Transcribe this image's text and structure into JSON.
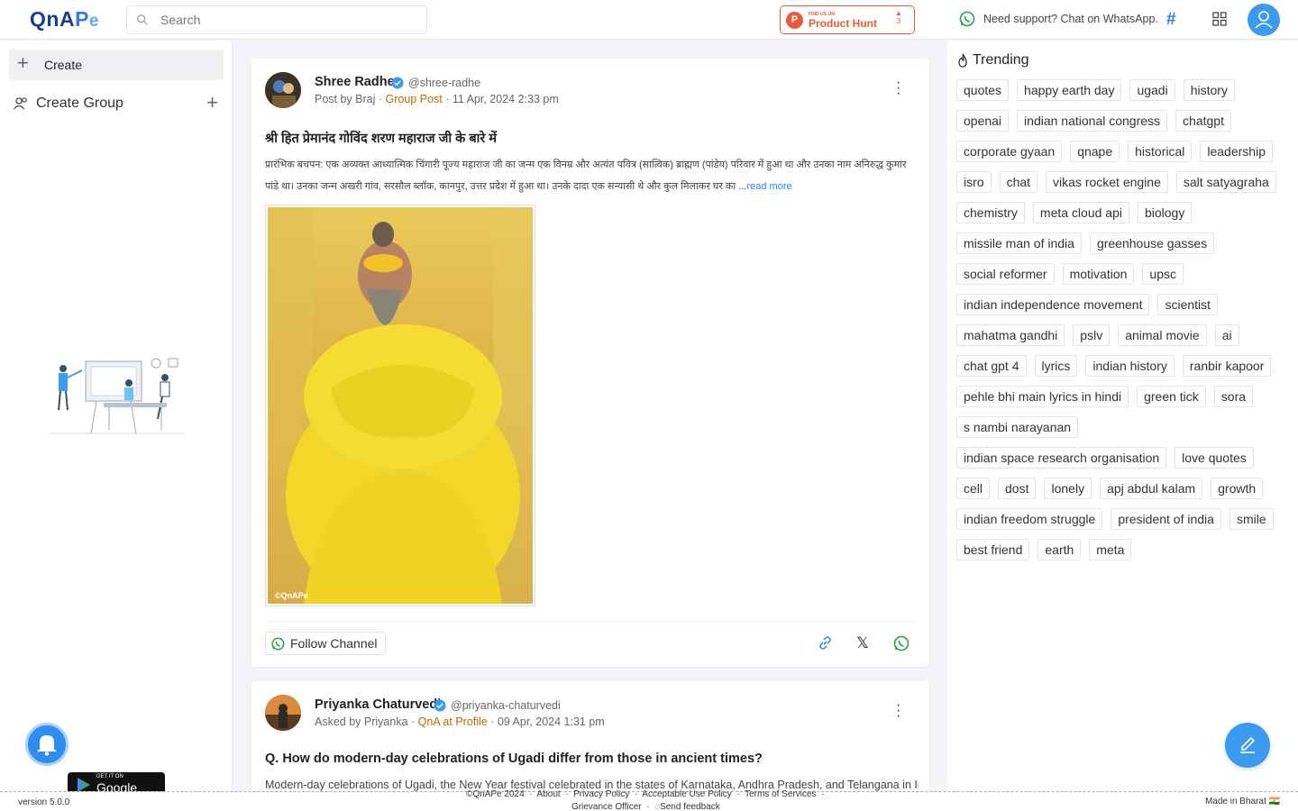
{
  "header": {
    "logo": {
      "part1": "QnA",
      "part2": "P",
      "part3": "e"
    },
    "search_placeholder": "Search",
    "product_hunt": {
      "small": "FIND US ON",
      "big": "Product Hunt",
      "upvotes": "3"
    },
    "support_text": "Need support? Chat on WhatsApp."
  },
  "sidebar": {
    "create_label": "Create",
    "create_group_label": "Create Group",
    "google_play": {
      "small": "GET IT ON",
      "big": "Google Play"
    }
  },
  "posts": [
    {
      "author": "Shree Radhe",
      "handle": "@shree-radhe",
      "meta_prefix": "Post by Braj · ",
      "meta_link": "Group Post",
      "meta_suffix": " · 11 Apr, 2024 2:33 pm",
      "title": "श्री हित प्रेमानंद गोविंद शरण महाराज जी के बारे में",
      "body": "प्रारंभिक बचपन: एक अव्यक्त आध्यात्मिक चिंगारी पूज्य महाराज जी का जन्म एक विनम्र और अत्यंत पवित्र (सात्विक) ब्राह्मण (पांडेय) परिवार में हुआ था और उनका नाम अनिरुद्ध कुमार पांडे था। उनका जन्म अखरी गांव, सरसौल ब्लॉक, कानपुर, उत्तर प्रदेश में हुआ था। उनके दादा एक सन्यासी थे और कुल मिलाकर घर का ...",
      "read_more": "read more",
      "image_watermark": "©QnAPe",
      "follow_label": "Follow Channel"
    },
    {
      "author": "Priyanka Chaturvedi",
      "handle": "@priyanka-chaturvedi",
      "meta_prefix": "Asked by Priyanka · ",
      "meta_link": "QnA at Profile",
      "meta_suffix": " · 09 Apr, 2024 1:31 pm",
      "title": "Q. How do modern-day celebrations of Ugadi differ from those in ancient times?",
      "body": "Modern-day celebrations of Ugadi, the New Year festival celebrated in the states of Karnataka, Andhra Pradesh, and Telangana in India,"
    }
  ],
  "trending": {
    "title": "Trending",
    "tags": [
      "quotes",
      "happy earth day",
      "ugadi",
      "history",
      "openai",
      "indian national congress",
      "chatgpt",
      "corporate gyaan",
      "qnape",
      "historical",
      "leadership",
      "isro",
      "chat",
      "vikas rocket engine",
      "salt satyagraha",
      "chemistry",
      "meta cloud api",
      "biology",
      "missile man of india",
      "greenhouse gasses",
      "social reformer",
      "motivation",
      "upsc",
      "indian independence movement",
      "scientist",
      "mahatma gandhi",
      "pslv",
      "animal movie",
      "ai",
      "chat gpt 4",
      "lyrics",
      "indian history",
      "ranbir kapoor",
      "pehle bhi main lyrics in hindi",
      "green tick",
      "sora",
      "s nambi narayanan",
      "indian space research organisation",
      "love quotes",
      "cell",
      "dost",
      "lonely",
      "apj abdul kalam",
      "growth",
      "indian freedom struggle",
      "president of india",
      "smile",
      "best friend",
      "earth",
      "meta"
    ]
  },
  "footer": {
    "version": "version 5.0.0",
    "copyright": "©QnAPe 2024",
    "about": "About",
    "privacy": "Privacy Policy",
    "aup": "Acceptable Use Policy",
    "terms": "Terms of Services",
    "grievance": "Grievance Officer",
    "feedback": "Send feedback",
    "made_in": "Made in Bharat 🇮🇳"
  },
  "colors": {
    "accent": "#2f7de1",
    "brand_dark": "#1a3f8f",
    "product_hunt": "#e85a3a",
    "whatsapp": "#25a244",
    "group_link": "#b86a00"
  }
}
